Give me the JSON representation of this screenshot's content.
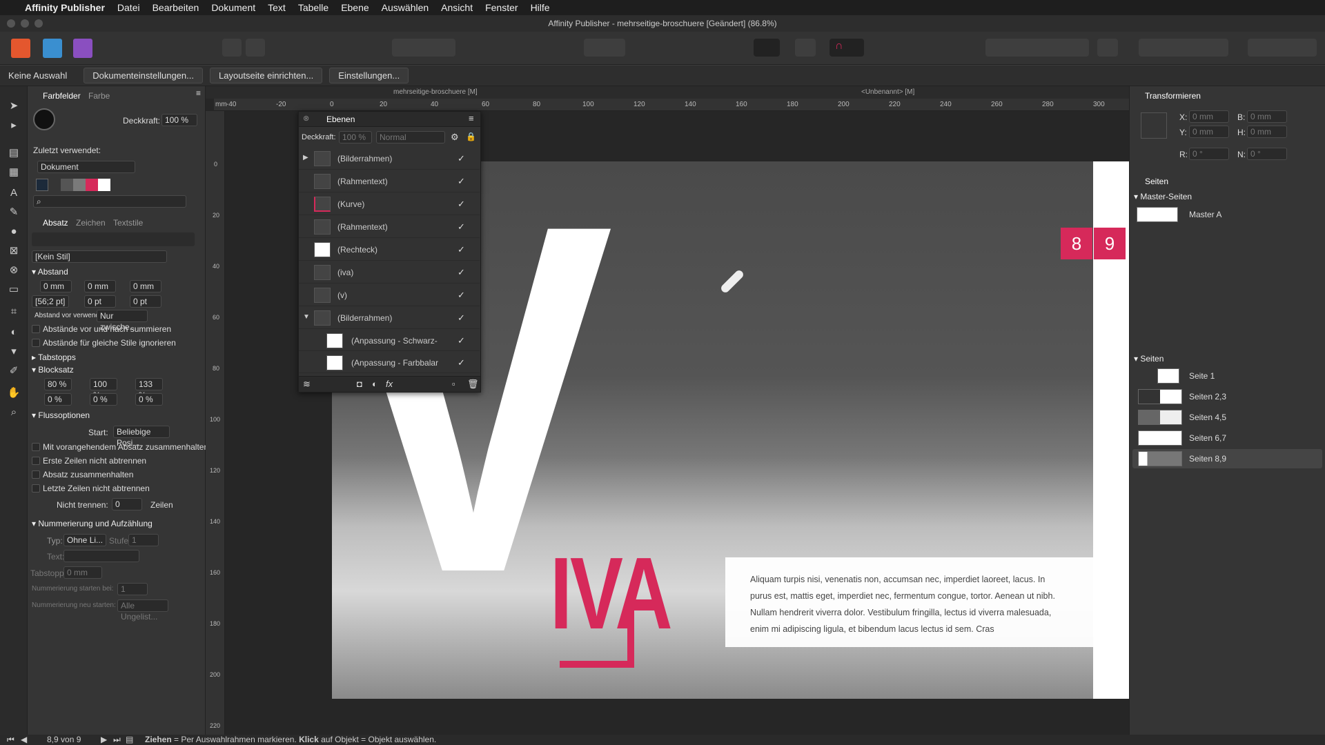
{
  "menubar": {
    "apple": "",
    "app": "Affinity Publisher",
    "items": [
      "Datei",
      "Bearbeiten",
      "Dokument",
      "Text",
      "Tabelle",
      "Ebene",
      "Auswählen",
      "Ansicht",
      "Fenster",
      "Hilfe"
    ]
  },
  "window": {
    "title": "Affinity Publisher - mehrseitige-broschuere [Geändert] (86.8%)"
  },
  "context": {
    "selection": "Keine Auswahl",
    "buttons": [
      "Dokumenteinstellungen...",
      "Layoutseite einrichten...",
      "Einstellungen..."
    ]
  },
  "doc": {
    "tab1": "mehrseitige-broschuere [M]",
    "tab2": "<Unbenannt> [M]",
    "units": "mm"
  },
  "ruler": {
    "h": [
      "-40",
      "-20",
      "0",
      "20",
      "40",
      "60",
      "80",
      "100",
      "120",
      "140",
      "160",
      "180",
      "200",
      "220",
      "240",
      "260",
      "280",
      "300"
    ],
    "v": [
      "0",
      "20",
      "40",
      "60",
      "80",
      "100",
      "120",
      "140",
      "160",
      "180",
      "200",
      "220"
    ]
  },
  "swatches": {
    "tab1": "Farbfelder",
    "tab2": "Farbe",
    "opacity_label": "Deckkraft:",
    "opacity": "100 %",
    "recent_label": "Zuletzt verwendet:",
    "palette": "Dokument",
    "colors": [
      "#1c2a3a",
      "#555555",
      "#7a7a7a",
      "#d6295a",
      "#ffffff"
    ]
  },
  "paragraph": {
    "tabs": [
      "Absatz",
      "Zeichen",
      "Textstile"
    ],
    "style": "[Kein Stil]",
    "spacing": {
      "title": "Abstand",
      "left": "0 mm",
      "right": "0 mm",
      "first": "0 mm",
      "leading": "[56;2 pt]",
      "before": "0 pt",
      "after": "0 pt",
      "apply_label": "Abstand vor verwenden:",
      "apply_value": "Nur zwische...",
      "sum": "Abstände vor und nach summieren",
      "ignore": "Abstände für gleiche Stile ignorieren"
    },
    "tabstops": "Tabstopps",
    "justify": {
      "title": "Blocksatz",
      "a": "80 %",
      "b": "100 %",
      "c": "133 %",
      "d": "0 %",
      "e": "0 %",
      "f": "0 %"
    },
    "flow": {
      "title": "Flussoptionen",
      "start_label": "Start:",
      "start_value": "Beliebige Posi...",
      "opt1": "Mit vorangehendem Absatz zusammenhalten",
      "opt2": "Erste Zeilen nicht abtrennen",
      "opt3": "Absatz zusammenhalten",
      "opt4": "Letzte Zeilen nicht abtrennen",
      "nobreak_label": "Nicht trennen:",
      "nobreak_value": "0",
      "nobreak_unit": "Zeilen"
    },
    "numbering": {
      "title": "Nummerierung und Aufzählung",
      "type_label": "Typ:",
      "type_value": "Ohne Li...",
      "level_label": "Stufe:",
      "level_value": "1",
      "text_label": "Text:",
      "tab_label": "Tabstopp:",
      "tab_value": "0 mm",
      "start_label": "Nummerierung starten bei:",
      "start_value": "1",
      "restart_label": "Nummerierung neu starten:",
      "restart_value": "Alle Ungelist..."
    }
  },
  "layers": {
    "title": "Ebenen",
    "opacity_label": "Deckkraft:",
    "opacity": "100 %",
    "blend": "Normal",
    "items": [
      {
        "name": "(Bilderrahmen)"
      },
      {
        "name": "(Rahmentext)"
      },
      {
        "name": "(Kurve)"
      },
      {
        "name": "(Rahmentext)"
      },
      {
        "name": "(Rechteck)"
      },
      {
        "name": "(iva)"
      },
      {
        "name": "(v)"
      },
      {
        "name": "(Bilderrahmen)"
      },
      {
        "name": "(Anpassung - Schwarz-"
      },
      {
        "name": "(Anpassung - Farbbalar"
      }
    ],
    "check": "✓"
  },
  "canvas": {
    "bigletter": "V",
    "word": "IVA",
    "page_num1": "8",
    "page_num2": "9",
    "body": "Aliquam turpis nisi, venenatis non, accumsan nec, imperdiet laoreet, lacus. In purus est, mattis eget, imperdiet nec, fermentum congue, tortor. Aenean ut nibh. Nullam hendrerit viverra dolor. Vestibulum fringilla, lectus id viverra malesuada, enim mi adipiscing ligula, et bibendum lacus lectus id sem. Cras",
    "accent": "#d6295a"
  },
  "transform": {
    "title": "Transformieren",
    "x_label": "X:",
    "x": "0 mm",
    "y_label": "Y:",
    "y": "0 mm",
    "b_label": "B:",
    "b": "0 mm",
    "h_label": "H:",
    "h": "0 mm",
    "r_label": "R:",
    "r": "0 °",
    "n_label": "N:",
    "n": "0 °"
  },
  "pages": {
    "title": "Seiten",
    "masters_title": "Master-Seiten",
    "master": "Master A",
    "pages_title": "Seiten",
    "items": [
      "Seite 1",
      "Seiten 2,3",
      "Seiten 4,5",
      "Seiten 6,7",
      "Seiten 8,9"
    ]
  },
  "status": {
    "page": "8,9 von 9",
    "hint_bold1": "Ziehen",
    "hint1": " = Per Auswahlrahmen markieren. ",
    "hint_bold2": "Klick",
    "hint2": " auf Objekt = Objekt auswählen."
  }
}
